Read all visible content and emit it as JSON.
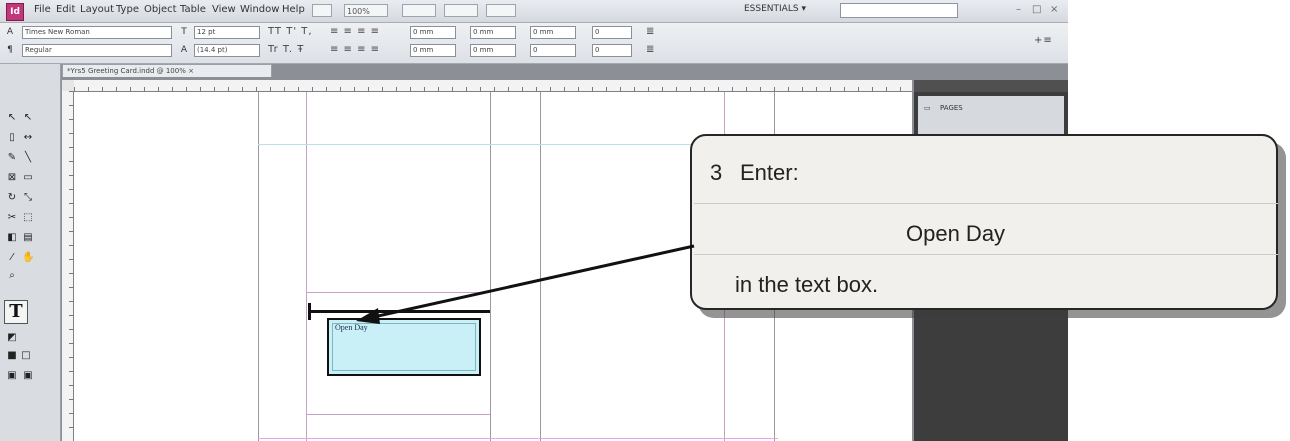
{
  "menubar": {
    "logo": "Id",
    "items": [
      "File",
      "Edit",
      "Layout",
      "Type",
      "Object",
      "Table",
      "View",
      "Window",
      "Help"
    ],
    "zoom": "100%",
    "workspace": "ESSENTIALS",
    "workspace_chevron": "▾",
    "window_controls": [
      "–",
      "□",
      "×"
    ]
  },
  "control_panel": {
    "font_family": "Times New Roman",
    "font_style": "Regular",
    "font_size": "12 pt",
    "leading": "(14.4 pt)",
    "tracking_fields": [
      "0 mm",
      "0 mm",
      "0 mm",
      "0 mm",
      "0 mm",
      "0"
    ],
    "more_values": [
      "0",
      "0"
    ],
    "right_label": "+≡"
  },
  "document": {
    "tab_label": "*Yrs5 Greeting Card.indd @ 100%",
    "tab_close": "×"
  },
  "tools": {
    "type_tool": "T"
  },
  "text_frame": {
    "content": "Open Day"
  },
  "panels": {
    "pages_label": "PAGES"
  },
  "callout": {
    "step_number": "3",
    "instruction": "Enter:",
    "entry_text": "Open Day",
    "tail_text": "in the text box."
  }
}
